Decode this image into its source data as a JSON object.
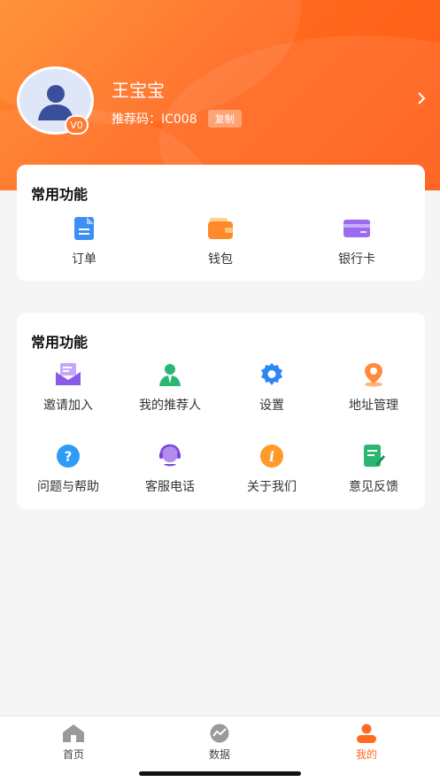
{
  "profile": {
    "name": "王宝宝",
    "level_badge": "V0",
    "referral_label": "推荐码：IC008",
    "copy_label": "复制"
  },
  "card_common": {
    "title": "常用功能",
    "items": [
      {
        "label": "订单",
        "icon": "order-icon"
      },
      {
        "label": "钱包",
        "icon": "wallet-icon"
      },
      {
        "label": "银行卡",
        "icon": "bank-card-icon"
      }
    ]
  },
  "card_more": {
    "title": "常用功能",
    "items": [
      {
        "label": "邀请加入",
        "icon": "invite-icon"
      },
      {
        "label": "我的推荐人",
        "icon": "referrer-icon"
      },
      {
        "label": "设置",
        "icon": "settings-gear-icon"
      },
      {
        "label": "地址管理",
        "icon": "location-pin-icon"
      },
      {
        "label": "问题与帮助",
        "icon": "help-question-icon"
      },
      {
        "label": "客服电话",
        "icon": "customer-service-icon"
      },
      {
        "label": "关于我们",
        "icon": "info-icon"
      },
      {
        "label": "意见反馈",
        "icon": "feedback-edit-icon"
      }
    ]
  },
  "tabbar": {
    "tabs": [
      {
        "label": "首页",
        "icon": "home-icon"
      },
      {
        "label": "数据",
        "icon": "data-chart-icon"
      },
      {
        "label": "我的",
        "icon": "user-icon",
        "active": true
      }
    ]
  },
  "colors": {
    "brand": "#ff6a1f",
    "tab_active": "#ff6a1f",
    "tab_inactive": "#9a9a9a"
  }
}
